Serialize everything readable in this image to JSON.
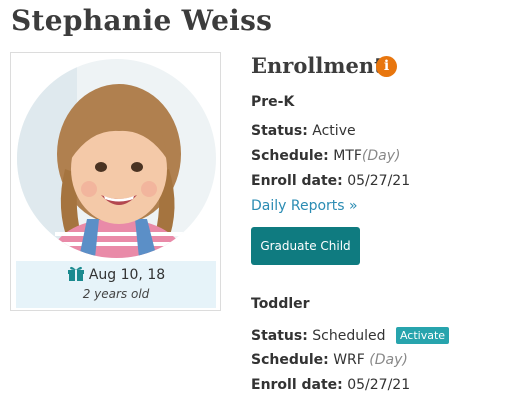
{
  "child": {
    "name": "Stephanie Weiss",
    "birthday": "Aug 10, 18",
    "age": "2 years old"
  },
  "enrollment": {
    "title": "Enrollment",
    "info_icon": "i",
    "programs": [
      {
        "name": "Pre-K",
        "status_label": "Status:",
        "status": "Active",
        "schedule_label": "Schedule:",
        "schedule": "MTF",
        "schedule_note": "(Day)",
        "enroll_label": "Enroll date:",
        "enroll_date": "05/27/21",
        "reports_link": "Daily Reports »",
        "graduate_button": "Graduate Child"
      },
      {
        "name": "Toddler",
        "status_label": "Status:",
        "status": "Scheduled",
        "activate_badge": "Activate",
        "schedule_label": "Schedule:",
        "schedule": "WRF",
        "schedule_note": "(Day)",
        "enroll_label": "Enroll date:",
        "enroll_date": "05/27/21"
      }
    ]
  },
  "colors": {
    "accent_teal": "#0f7b80",
    "badge_teal": "#27a4ad",
    "link_blue": "#2b8cb3",
    "info_orange": "#e8760e",
    "birthday_bg": "#e6f3f9"
  },
  "icons": {
    "info": "info-icon",
    "birthday": "gift-icon"
  }
}
